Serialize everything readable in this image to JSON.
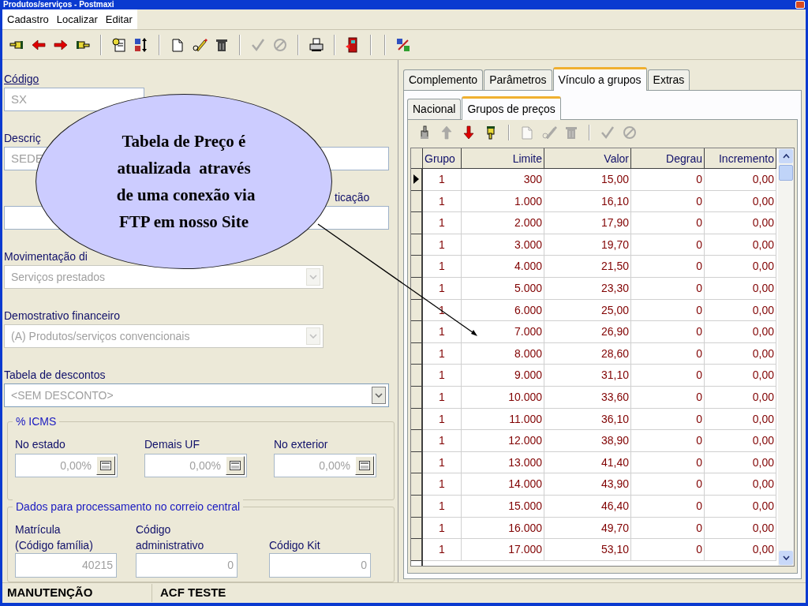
{
  "window": {
    "title": "Produtos/serviços - Postmaxi"
  },
  "menu": [
    "Cadastro",
    "Localizar",
    "Editar"
  ],
  "toolbar": [
    {
      "kind": "hand-left",
      "disabled": false
    },
    {
      "kind": "arrow-left",
      "disabled": false
    },
    {
      "kind": "arrow-right",
      "disabled": false
    },
    {
      "kind": "hand-right",
      "disabled": false
    },
    {
      "kind": "sep"
    },
    {
      "kind": "search-doc",
      "disabled": false
    },
    {
      "kind": "sort",
      "disabled": false
    },
    {
      "kind": "sep"
    },
    {
      "kind": "new",
      "disabled": false
    },
    {
      "kind": "edit",
      "disabled": false
    },
    {
      "kind": "trash",
      "disabled": false
    },
    {
      "kind": "sep"
    },
    {
      "kind": "check",
      "disabled": true
    },
    {
      "kind": "cancel",
      "disabled": true
    },
    {
      "kind": "sep"
    },
    {
      "kind": "print",
      "disabled": false
    },
    {
      "kind": "sep"
    },
    {
      "kind": "exit",
      "disabled": false
    },
    {
      "kind": "sep"
    },
    {
      "kind": "sep"
    },
    {
      "kind": "tools",
      "disabled": false
    }
  ],
  "fields": [
    {
      "kind": "text",
      "label": "Código",
      "value": "SX"
    },
    {
      "kind": "text",
      "label": "Descriç",
      "value": "SEDE"
    },
    {
      "kind": "text",
      "label": "ticação"
    },
    {
      "kind": "combo",
      "label": "Movimentação di",
      "value": "Serviços prestados",
      "disabled": true
    },
    {
      "kind": "combo",
      "label": "Demostrativo financeiro",
      "value": "(A) Produtos/serviços convencionais",
      "disabled": true
    },
    {
      "kind": "combo",
      "label": "Tabela de descontos",
      "value": "<SEM DESCONTO>",
      "disabled": false
    }
  ],
  "icms": {
    "title": "% ICMS",
    "items": [
      {
        "label": "No estado",
        "value": "0,00%"
      },
      {
        "label": "Demais UF",
        "value": "0,00%"
      },
      {
        "label": "No exterior",
        "value": "0,00%"
      }
    ]
  },
  "correio": {
    "title": "Dados para processamento no correio central",
    "items": [
      {
        "label": "Matrícula\n(Código família)",
        "value": "40215"
      },
      {
        "label": "Código\nadministrativo",
        "value": "0"
      },
      {
        "label": "Código Kit",
        "value": "0"
      }
    ]
  },
  "callout": {
    "text": "Tabela de Preço é\natualizada  através\n de uma conexão via\nFTP em nosso Site"
  },
  "tabs": [
    {
      "label": "Complemento",
      "selected": false
    },
    {
      "label": "Parâmetros",
      "selected": false
    },
    {
      "label": "Vínculo a grupos",
      "selected": true
    },
    {
      "label": "Extras",
      "selected": false
    }
  ],
  "subtabs": [
    {
      "label": "Nacional",
      "selected": false
    },
    {
      "label": "Grupos de preços",
      "selected": true
    }
  ],
  "grid_toolbar": [
    {
      "kind": "hand-up",
      "disabled": true
    },
    {
      "kind": "arrow-up",
      "disabled": true
    },
    {
      "kind": "arrow-down",
      "disabled": false
    },
    {
      "kind": "hand-down",
      "disabled": false
    },
    {
      "kind": "sep"
    },
    {
      "kind": "new",
      "disabled": true
    },
    {
      "kind": "edit",
      "disabled": true
    },
    {
      "kind": "trash",
      "disabled": true
    },
    {
      "kind": "sep"
    },
    {
      "kind": "check",
      "disabled": true
    },
    {
      "kind": "cancel",
      "disabled": true
    }
  ],
  "table": {
    "columns": [
      "Grupo",
      "Limite",
      "Valor",
      "Degrau",
      "Incremento"
    ],
    "rows": [
      {
        "cells": [
          "1",
          "300",
          "15,00",
          "0",
          "0,00"
        ],
        "selected": true
      },
      {
        "cells": [
          "1",
          "1.000",
          "16,10",
          "0",
          "0,00"
        ],
        "selected": false
      },
      {
        "cells": [
          "1",
          "2.000",
          "17,90",
          "0",
          "0,00"
        ],
        "selected": false
      },
      {
        "cells": [
          "1",
          "3.000",
          "19,70",
          "0",
          "0,00"
        ],
        "selected": false
      },
      {
        "cells": [
          "1",
          "4.000",
          "21,50",
          "0",
          "0,00"
        ],
        "selected": false
      },
      {
        "cells": [
          "1",
          "5.000",
          "23,30",
          "0",
          "0,00"
        ],
        "selected": false
      },
      {
        "cells": [
          "1",
          "6.000",
          "25,00",
          "0",
          "0,00"
        ],
        "selected": false
      },
      {
        "cells": [
          "1",
          "7.000",
          "26,90",
          "0",
          "0,00"
        ],
        "selected": false
      },
      {
        "cells": [
          "1",
          "8.000",
          "28,60",
          "0",
          "0,00"
        ],
        "selected": false
      },
      {
        "cells": [
          "1",
          "9.000",
          "31,10",
          "0",
          "0,00"
        ],
        "selected": false
      },
      {
        "cells": [
          "1",
          "10.000",
          "33,60",
          "0",
          "0,00"
        ],
        "selected": false
      },
      {
        "cells": [
          "1",
          "11.000",
          "36,10",
          "0",
          "0,00"
        ],
        "selected": false
      },
      {
        "cells": [
          "1",
          "12.000",
          "38,90",
          "0",
          "0,00"
        ],
        "selected": false
      },
      {
        "cells": [
          "1",
          "13.000",
          "41,40",
          "0",
          "0,00"
        ],
        "selected": false
      },
      {
        "cells": [
          "1",
          "14.000",
          "43,90",
          "0",
          "0,00"
        ],
        "selected": false
      },
      {
        "cells": [
          "1",
          "15.000",
          "46,40",
          "0",
          "0,00"
        ],
        "selected": false
      },
      {
        "cells": [
          "1",
          "16.000",
          "49,70",
          "0",
          "0,00"
        ],
        "selected": false
      },
      {
        "cells": [
          "1",
          "17.000",
          "53,10",
          "0",
          "0,00"
        ],
        "selected": false
      }
    ]
  },
  "status_bar": [
    "MANUTENÇÃO",
    "ACF TESTE"
  ]
}
